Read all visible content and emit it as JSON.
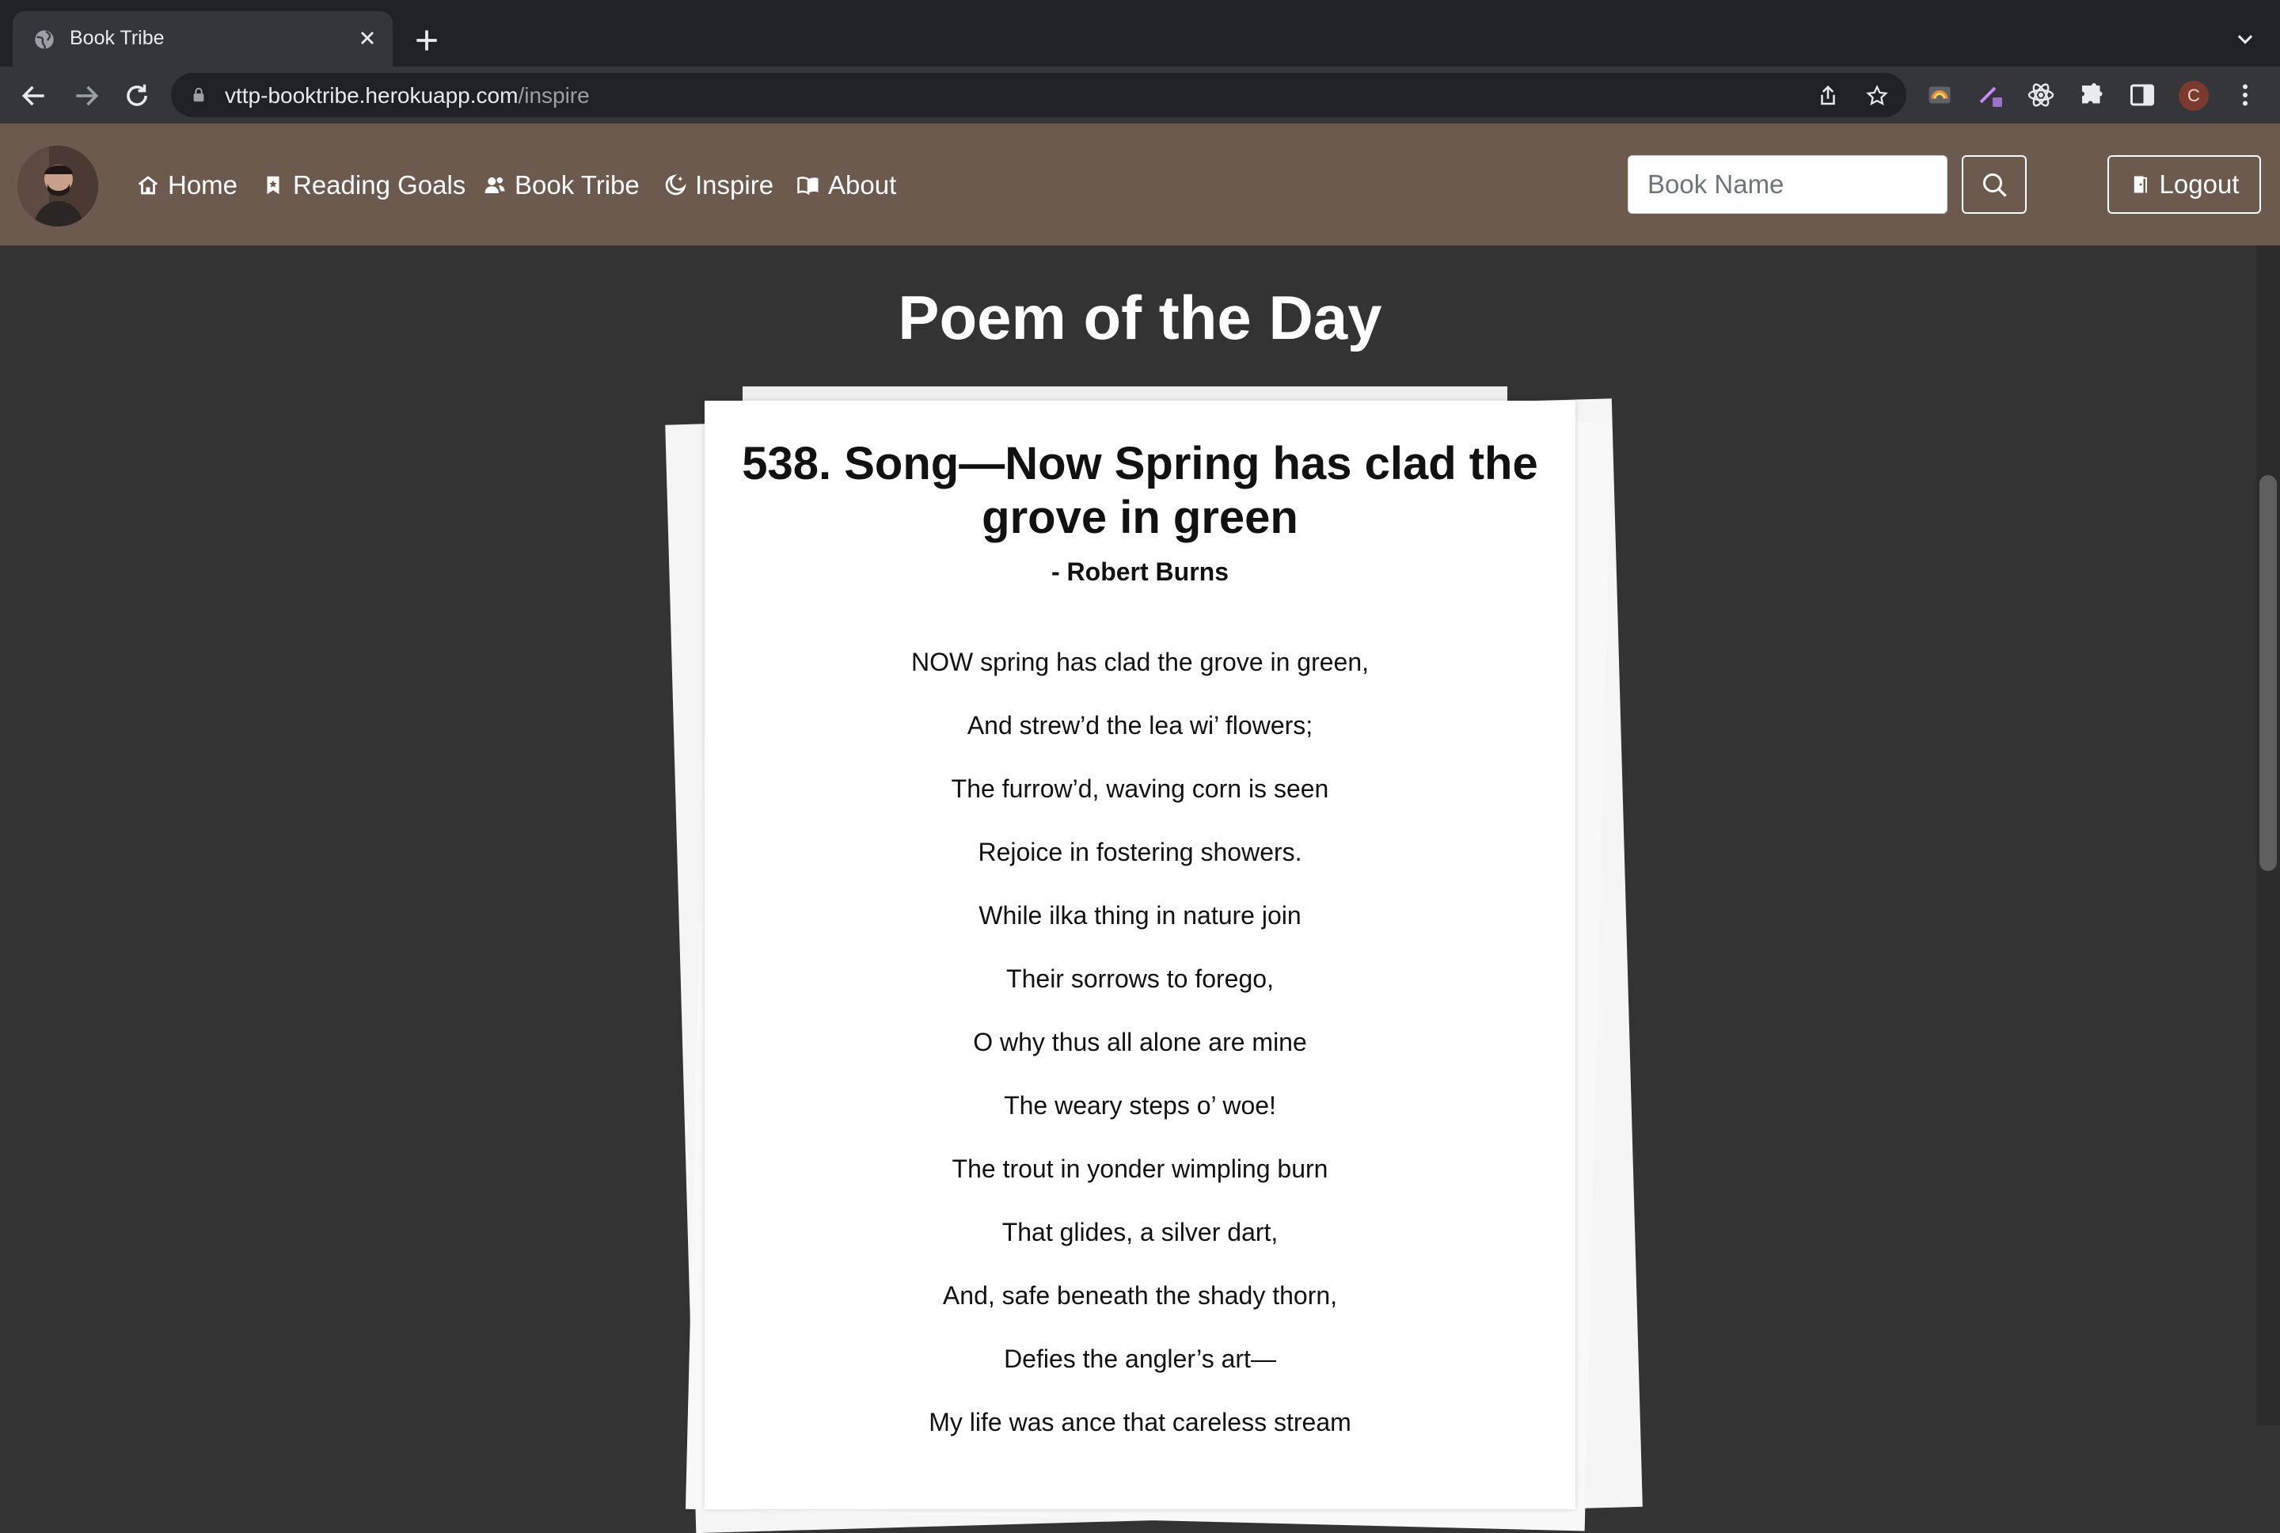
{
  "browser": {
    "tab_title": "Book Tribe",
    "url_host": "vttp-booktribe.herokuapp.com",
    "url_path": "/inspire",
    "profile_initial": "C"
  },
  "navbar": {
    "links": [
      {
        "label": "Home",
        "icon": "house-icon"
      },
      {
        "label": "Reading Goals",
        "icon": "bookmark-icon"
      },
      {
        "label": "Book Tribe",
        "icon": "people-icon"
      },
      {
        "label": "Inspire",
        "icon": "moon-stars-icon"
      },
      {
        "label": "About",
        "icon": "book-open-icon"
      }
    ],
    "search_placeholder": "Book Name",
    "logout_label": "Logout"
  },
  "page": {
    "title": "Poem of the Day"
  },
  "poem": {
    "title": "538. Song—Now Spring has clad the grove in green",
    "author": "- Robert Burns",
    "lines": [
      "NOW spring has clad the grove in green,",
      "And strew’d the lea wi’ flowers;",
      "The furrow’d, waving corn is seen",
      "Rejoice in fostering showers.",
      "While ilka thing in nature join",
      "Their sorrows to forego,",
      "O why thus all alone are mine",
      "The weary steps o’ woe!",
      "The trout in yonder wimpling burn",
      "That glides, a silver dart,",
      "And, safe beneath the shady thorn,",
      "Defies the angler’s art—",
      "My life was ance that careless stream"
    ]
  },
  "colors": {
    "navbar_bg": "#6d5a4f",
    "page_bg": "#333333",
    "paper_bg": "#ffffff"
  }
}
